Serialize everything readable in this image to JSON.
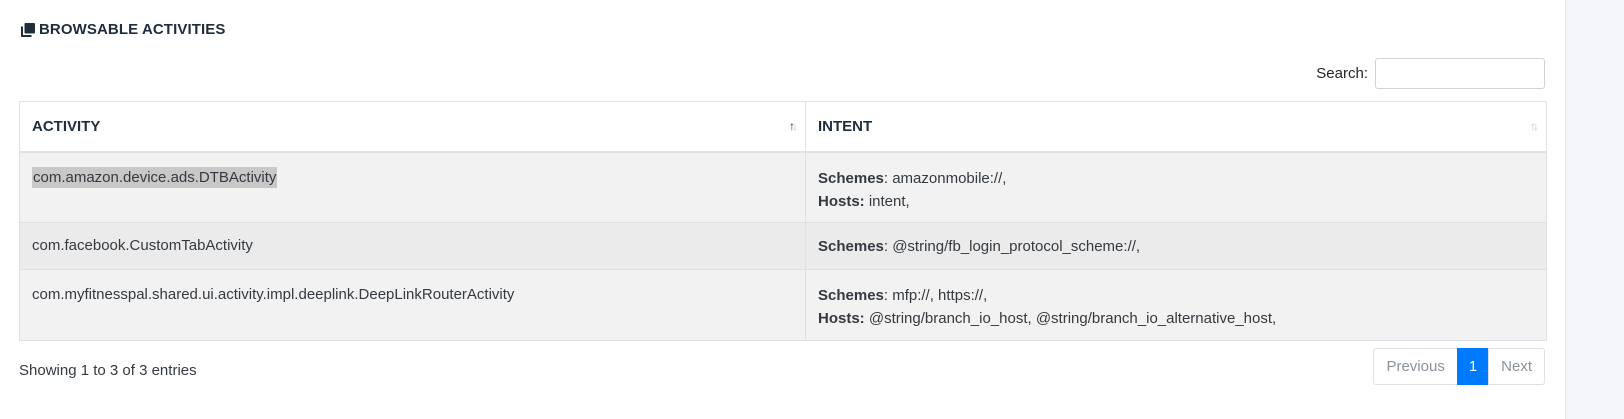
{
  "section": {
    "title": "BROWSABLE ACTIVITIES",
    "icon": "copy-icon"
  },
  "search": {
    "label": "Search:",
    "value": "",
    "placeholder": ""
  },
  "table": {
    "columns": [
      {
        "label": "ACTIVITY",
        "sort": "ascending"
      },
      {
        "label": "INTENT",
        "sort": "none"
      }
    ],
    "rows": [
      {
        "activity": "com.amazon.device.ads.DTBActivity",
        "schemes_label": "Schemes",
        "schemes": ": amazonmobile://,",
        "hosts_label": "Hosts:",
        "hosts": " intent,"
      },
      {
        "activity": "com.facebook.CustomTabActivity",
        "schemes_label": "Schemes",
        "schemes": ": @string/fb_login_protocol_scheme://,"
      },
      {
        "activity": "com.myfitnesspal.shared.ui.activity.impl.deeplink.DeepLinkRouterActivity",
        "schemes_label": "Schemes",
        "schemes": ": mfp://, https://,",
        "hosts_label": "Hosts:",
        "hosts": " @string/branch_io_host, @string/branch_io_alternative_host,"
      }
    ]
  },
  "footer": {
    "info": "Showing 1 to 3 of 3 entries",
    "pagination": {
      "previous": "Previous",
      "current": "1",
      "next": "Next"
    }
  },
  "colors": {
    "accent": "#007bff",
    "row_odd": "#f2f2f2",
    "row_even": "#ebebeb",
    "highlight": "#c8c8c8"
  }
}
